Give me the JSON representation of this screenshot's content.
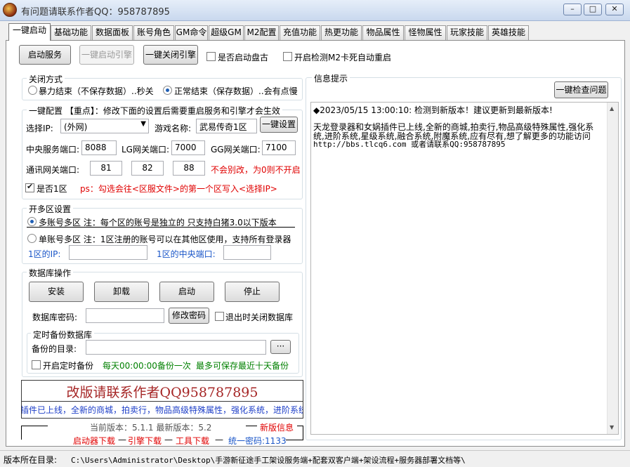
{
  "window": {
    "title": "有问题请联系作者QQ：958787895",
    "minimize_glyph": "–",
    "maximize_glyph": "□",
    "close_glyph": "✕"
  },
  "tabs": [
    {
      "label": "一键启动",
      "active": true
    },
    {
      "label": "基础功能"
    },
    {
      "label": "数据面板"
    },
    {
      "label": "账号角色"
    },
    {
      "label": "GM命令"
    },
    {
      "label": "超级GM"
    },
    {
      "label": "M2配置"
    },
    {
      "label": "充值功能"
    },
    {
      "label": "热更功能"
    },
    {
      "label": "物品属性"
    },
    {
      "label": "怪物属性"
    },
    {
      "label": "玩家技能"
    },
    {
      "label": "英雄技能"
    }
  ],
  "toolbar": {
    "start_service": "启动服务",
    "start_engine": "一键启动引擎",
    "close_engine": "一键关闭引擎",
    "auto_disk": "是否启动盘古",
    "m2_restart": "开启检测M2卡死自动重启"
  },
  "close_mode": {
    "title": "关闭方式",
    "force": "暴力结束（不保存数据）..秒关",
    "normal": "正常结束（保存数据）..会有点慢"
  },
  "config": {
    "title": "一键配置 【重点】：修改下面的设置后需要重启服务和引擎才会生效",
    "ip_label": "选择IP:",
    "ip_value": "(外网)",
    "game_name_label": "游戏名称:",
    "game_name_value": "武易传奇1区",
    "set_button": "一键设置",
    "central_port_label": "中央服务端口:",
    "central_port": "8088",
    "lg_port_label": "LG网关端口:",
    "lg_port": "7000",
    "gg_port_label": "GG网关端口:",
    "gg_port": "7100",
    "comm_port_label": "通讯网关端口:",
    "comm_ports": [
      "81",
      "82",
      "88"
    ],
    "comm_warning": "不会别改，为0则不开启",
    "is_zone1": "是否1区",
    "zone1_tip": "ps：勾选会往<区服文件>的第一个区写入<选择IP>"
  },
  "multi_zone": {
    "title": "开多区设置",
    "multi_account": "多账号多区 注：每个区的账号是独立的 只支持白猪3.0以下版本",
    "single_account": "单账号多区 注：1区注册的账号可以在其他区使用，支持所有登录器",
    "zone1_ip_label": "1区的IP:",
    "zone1_port_label": "1区的中央端口:"
  },
  "database": {
    "title": "数据库操作",
    "install": "安装",
    "uninstall": "卸载",
    "start": "启动",
    "stop": "停止",
    "password_label": "数据库密码:",
    "change_password": "修改密码",
    "close_on_exit": "退出时关闭数据库",
    "backup_title": "定时备份数据库",
    "backup_dir_label": "备份的目录:",
    "browse": "···",
    "enable_backup": "开启定时备份",
    "backup_time": "每天00:00:00备份一次",
    "backup_keep": "最多可保存最近十天备份"
  },
  "banner": {
    "title": "改版请联系作者QQ958787895",
    "scroll_text": "插件已上线，全新的商城，拍卖行，物品高级特殊属性，强化系统，进阶系统，星级"
  },
  "version": {
    "text": "当前版本：5.1.1  最新版本：5.2",
    "new_info": "新版信息",
    "launcher_download": "启动器下载",
    "engine_download": "引擎下载",
    "tool_download": "工具下载",
    "unified_password": "统一密码:1133"
  },
  "info": {
    "title": "信息提示",
    "check_button": "一键检查问题",
    "line1": "◆2023/05/15 13:00:10:  检测到新版本！建议更新到最新版本!",
    "line2": "天龙登录器和女娲插件已上线,全新的商城,拍卖行,物品高级特殊属性,强化系",
    "line3": "统,进阶系统,星级系统,融合系统,附魔系统,应有尽有,想了解更多的功能访问",
    "line4": "http://bbs.tlcq6.com 或者请联系QQ:958787895"
  },
  "status": {
    "label": "版本所在目录:",
    "path": "C:\\Users\\Administrator\\Desktop\\手游新征途手工架设服务端+配套双客户端+架设流程+服务器部署文档等\\"
  },
  "icons": {
    "dropdown": "dropdown-arrow-icon",
    "scroll_up": "scroll-up-icon",
    "scroll_down": "scroll-down-icon"
  }
}
